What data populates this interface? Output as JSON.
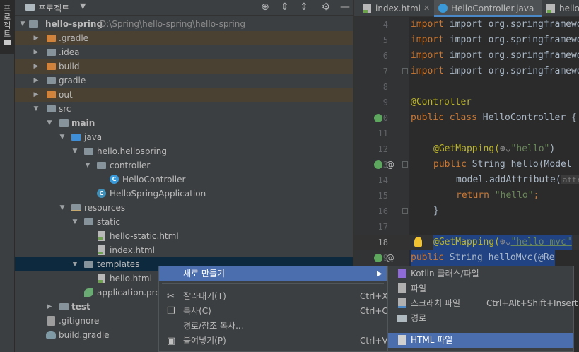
{
  "sidebar": {
    "label": "프로젝트"
  },
  "project": {
    "title": "프로젝트",
    "toolbar": {
      "locate": "⊕",
      "expand": "⇕",
      "collapse": "⇕",
      "settings": "⚙",
      "hide": "—"
    },
    "root_path": "D:\\Spring\\hello-spring\\hello-spring",
    "tree": [
      {
        "label": "hello-spring"
      },
      {
        "label": ".gradle"
      },
      {
        "label": ".idea"
      },
      {
        "label": "build"
      },
      {
        "label": "gradle"
      },
      {
        "label": "out"
      },
      {
        "label": "src"
      },
      {
        "label": "main"
      },
      {
        "label": "java"
      },
      {
        "label": "hello.hellospring"
      },
      {
        "label": "controller"
      },
      {
        "label": "HelloController"
      },
      {
        "label": "HelloSpringApplication"
      },
      {
        "label": "resources"
      },
      {
        "label": "static"
      },
      {
        "label": "hello-static.html"
      },
      {
        "label": "index.html"
      },
      {
        "label": "templates"
      },
      {
        "label": "hello.html"
      },
      {
        "label": "application.prop"
      },
      {
        "label": "test"
      },
      {
        "label": ".gitignore"
      },
      {
        "label": "build.gradle"
      }
    ]
  },
  "editor": {
    "tabs": [
      {
        "label": "index.html"
      },
      {
        "label": "HelloController.java"
      },
      {
        "label": "hello"
      }
    ],
    "lines": [
      {
        "n": "4",
        "t": "import org.springframework.ste"
      },
      {
        "n": "5",
        "t": "import org.springframework.ui."
      },
      {
        "n": "6",
        "t": "import org.springframework.web."
      },
      {
        "n": "7",
        "t": "import org.springframework.web"
      },
      {
        "n": "8",
        "t": ""
      },
      {
        "n": "9",
        "t": ""
      },
      {
        "n": "10",
        "kw": "public class ",
        "t": "HelloController {"
      },
      {
        "n": "11",
        "t": ""
      },
      {
        "n": "12",
        "a": "@GetMapping(",
        "s": "\"hello\"",
        "e": ")"
      },
      {
        "n": "13",
        "kw": "public ",
        "t": "String hello(Model "
      },
      {
        "n": "14",
        "t": "model.addAttribute(",
        "hint": "attr"
      },
      {
        "n": "15",
        "kw": "return ",
        "s": "\"hello\"",
        "e": ";"
      },
      {
        "n": "16",
        "t": "}"
      },
      {
        "n": "17",
        "t": ""
      },
      {
        "n": "18",
        "a": "@GetMapping(",
        "s": "\"hello-mvc\""
      },
      {
        "n": "19",
        "kw": "public ",
        "t": "String helloMvc(@Re"
      }
    ],
    "controller_annotation": "@Controller"
  },
  "context_menu": {
    "items": [
      {
        "label": "새로 만들기"
      },
      {
        "label": "잘라내기(T)",
        "shortcut": "Ctrl+X"
      },
      {
        "label": "복사(C)",
        "shortcut": "Ctrl+C"
      },
      {
        "label": "경로/참조 복사..."
      },
      {
        "label": "붙여넣기(P)",
        "shortcut": "Ctrl+V"
      }
    ]
  },
  "submenu": {
    "items": [
      {
        "label": "Kotlin 클래스/파일"
      },
      {
        "label": "파일"
      },
      {
        "label": "스크래치 파일",
        "shortcut": "Ctrl+Alt+Shift+Insert"
      },
      {
        "label": "경로"
      },
      {
        "label": "HTML 파일"
      }
    ]
  }
}
